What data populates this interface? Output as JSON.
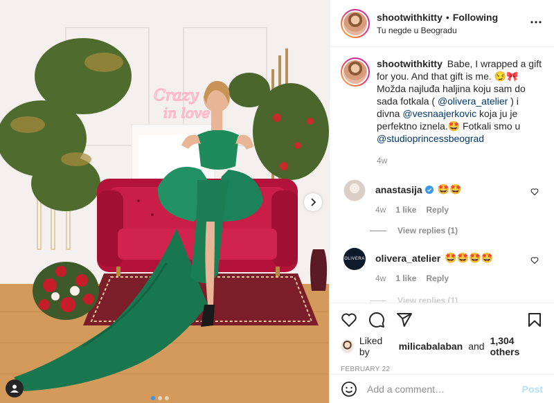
{
  "post": {
    "username": "shootwithkitty",
    "separator": "•",
    "follow_status": "Following",
    "location": "Tu negde u Beogradu",
    "neon_sign_line1": "Crazy",
    "neon_sign_line2": "in love",
    "carousel_dots": 3,
    "active_dot": 0
  },
  "caption": {
    "username": "shootwithkitty",
    "text_1": "Babe, I wrapped a gift for you. And that gift is me. 😏🎀 Možda najluđa haljina koju sam do sada fotkala ( ",
    "mention_1": "@olivera_atelier",
    "text_2": " ) i divna ",
    "mention_2": "@vesnaajerkovic",
    "text_3": " koja ju je perfektno iznela.🤩 Fotkali smo u ",
    "mention_3": "@studioprincessbeograd",
    "time": "4w"
  },
  "comments": [
    {
      "username": "anastasija",
      "verified": true,
      "text": "🤩🤩",
      "time": "4w",
      "likes": "1 like",
      "reply": "Reply",
      "view_replies": "View replies (1)"
    },
    {
      "username": "olivera_atelier",
      "avatar_text": "OLIVERA",
      "text": "🤩🤩🤩🤩",
      "time": "4w",
      "likes": "1 like",
      "reply": "Reply",
      "view_replies": "View replies (1)"
    }
  ],
  "likes": {
    "prefix": "Liked by",
    "user": "milicabalaban",
    "conj": "and",
    "others": "1,304 others"
  },
  "date": "FEBRUARY 22",
  "add_comment": {
    "placeholder": "Add a comment…",
    "post_label": "Post"
  },
  "colors": {
    "dress": "#1f8a5c",
    "sofa": "#c2163f",
    "link": "#00376b",
    "verified": "#3897f0",
    "post_disabled": "#b2dffc"
  },
  "icons": [
    "more-icon",
    "heart-icon",
    "comment-icon",
    "share-icon",
    "save-icon",
    "emoji-icon",
    "verified-icon",
    "chevron-right-icon",
    "user-tag-icon"
  ]
}
